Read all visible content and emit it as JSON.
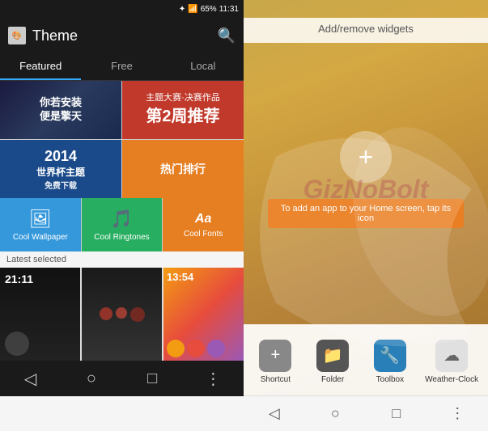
{
  "status_bar": {
    "time": "11:31",
    "battery": "65%"
  },
  "left_panel": {
    "header_title": "Theme",
    "tabs": [
      {
        "label": "Featured",
        "active": true
      },
      {
        "label": "Free",
        "active": false
      },
      {
        "label": "Local",
        "active": false
      }
    ],
    "grid_cells": [
      {
        "id": "cell1",
        "text_line1": "你若安装",
        "text_line2": "便是擎天",
        "style": "dark"
      },
      {
        "id": "cell2",
        "text_line1": "主题大赛·决赛作品",
        "text_line2": "第2周推荐",
        "style": "red"
      },
      {
        "id": "cell3",
        "text_line1": "2014",
        "text_line2": "世界杯主题",
        "text_line3": "免费下载",
        "style": "blue"
      },
      {
        "id": "cell4",
        "text_line1": "热门排行",
        "style": "orange"
      }
    ],
    "bottom_tiles": [
      {
        "label": "Cool Wallpaper",
        "icon": "🖼",
        "style": "blue"
      },
      {
        "label": "Cool Ringtones",
        "icon": "🎵",
        "style": "green"
      },
      {
        "label": "Cool Fonts",
        "icon": "Aa",
        "style": "orange"
      }
    ],
    "latest_section_label": "Latest selected",
    "thumbnails": [
      {
        "time": "21:11",
        "style": "dark"
      },
      {
        "style": "cartoon"
      },
      {
        "time": "13:54",
        "style": "colorful"
      }
    ]
  },
  "right_panel": {
    "top_label": "Add/remove widgets",
    "add_btn_label": "+",
    "tooltip": "To add an app to your Home screen, tap its icon",
    "watermark": "GizNoBolt",
    "widget_items": [
      {
        "label": "Shortcut",
        "icon": "+",
        "icon_style": "gray"
      },
      {
        "label": "Folder",
        "icon": "📁",
        "icon_style": "dark"
      },
      {
        "label": "Toolbox",
        "icon": "🔧",
        "icon_style": "blue"
      },
      {
        "label": "Weather-Clock",
        "icon": "☁",
        "icon_style": "light"
      }
    ]
  },
  "nav": {
    "back": "◁",
    "home": "○",
    "recent": "□",
    "more": "⋮"
  }
}
